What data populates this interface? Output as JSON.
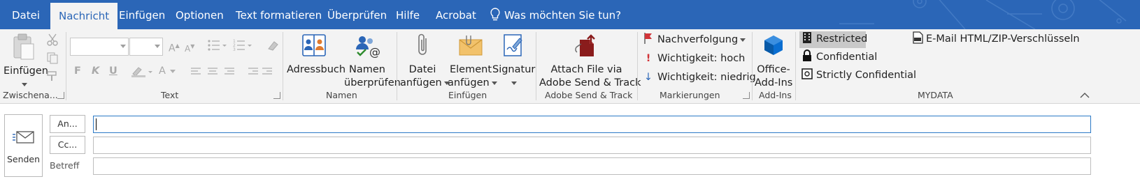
{
  "tabs": [
    {
      "label": "Datei"
    },
    {
      "label": "Nachricht"
    },
    {
      "label": "Einfügen"
    },
    {
      "label": "Optionen"
    },
    {
      "label": "Text formatieren"
    },
    {
      "label": "Überprüfen"
    },
    {
      "label": "Hilfe"
    },
    {
      "label": "Acrobat"
    }
  ],
  "tell_me": "Was möchten Sie tun?",
  "clipboard": {
    "paste": "Einfügen",
    "group": "Zwischena..."
  },
  "text_group": {
    "bold": "F",
    "italic": "K",
    "underline": "U",
    "font_color": "A",
    "grow": "A",
    "shrink": "A",
    "group": "Text"
  },
  "names": {
    "address_book": "Adressbuch",
    "check_line1": "Namen",
    "check_line2": "überprüfen",
    "group": "Namen"
  },
  "insert": {
    "attach_line1": "Datei",
    "attach_line2": "anfügen",
    "item_line1": "Element",
    "item_line2": "anfügen",
    "signature": "Signatur",
    "group": "Einfügen"
  },
  "adobe": {
    "line1": "Attach File via",
    "line2": "Adobe Send & Track",
    "group": "Adobe Send & Track"
  },
  "tags": {
    "followup": "Nachverfolgung",
    "high": "Wichtigkeit: hoch",
    "low": "Wichtigkeit: niedrig",
    "group": "Markierungen"
  },
  "addins": {
    "line1": "Office-",
    "line2": "Add-Ins",
    "group": "Add-Ins"
  },
  "mydata": {
    "restricted": "Restricted",
    "confidential": "Confidential",
    "strictly": "Strictly Confidential",
    "encrypt": "E-Mail HTML/ZIP-Verschlüsseln",
    "group": "MYDATA"
  },
  "compose": {
    "send": "Senden",
    "to": "An...",
    "cc": "Cc...",
    "subject": "Betreff",
    "to_value": "",
    "cc_value": "",
    "subject_value": ""
  },
  "colors": {
    "accent": "#2b66b7",
    "ribbon": "#f3f3f3",
    "flag": "#d13438",
    "office_blue": "#0a6ed1"
  },
  "icons": [
    "paste-icon",
    "cut-icon",
    "copy-icon",
    "format-painter-icon",
    "address-book-icon",
    "check-names-icon",
    "paperclip-icon",
    "envelope-icon",
    "signature-icon",
    "adobe-attach-icon",
    "flag-icon",
    "exclamation-icon",
    "arrow-down-icon",
    "office-addins-icon",
    "building-icon",
    "lock-icon",
    "safe-icon",
    "zip-icon",
    "lightbulb-icon",
    "send-envelope-icon",
    "collapse-ribbon-icon"
  ]
}
